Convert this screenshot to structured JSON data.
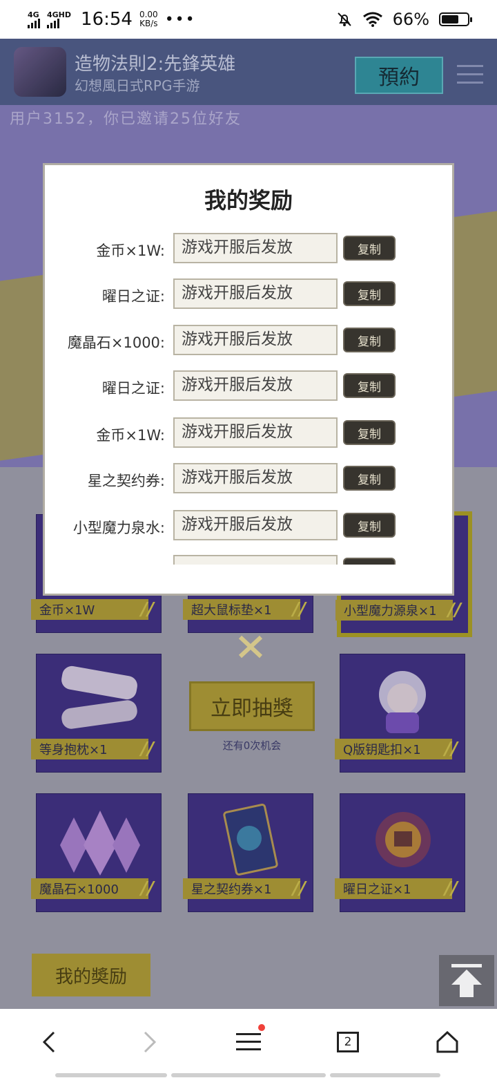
{
  "status_bar": {
    "signal1": "4G",
    "signal2": "4GHD",
    "time": "16:54",
    "speed_value": "0.00",
    "speed_unit": "KB/s",
    "more": "•••",
    "battery": "66%",
    "battery_level": 0.66
  },
  "header": {
    "title": "造物法則2:先鋒英雄",
    "subtitle": "幻想風日式RPG手游",
    "reserve_label": "預約"
  },
  "invite_text": "用户3152，你已邀请25位好友",
  "modal": {
    "title": "我的奖励",
    "rewards": [
      {
        "name": "金币×1W:",
        "value": "游戏开服后发放",
        "copy": "复制"
      },
      {
        "name": "曜日之证:",
        "value": "游戏开服后发放",
        "copy": "复制"
      },
      {
        "name": "魔晶石×1000:",
        "value": "游戏开服后发放",
        "copy": "复制"
      },
      {
        "name": "曜日之证:",
        "value": "游戏开服后发放",
        "copy": "复制"
      },
      {
        "name": "金币×1W:",
        "value": "游戏开服后发放",
        "copy": "复制"
      },
      {
        "name": "星之契约券:",
        "value": "游戏开服后发放",
        "copy": "复制"
      },
      {
        "name": "小型魔力泉水:",
        "value": "游戏开服后发放",
        "copy": "复制"
      },
      {
        "name": "",
        "value": "",
        "copy": ""
      }
    ]
  },
  "prizes": [
    {
      "label": "金币×1W"
    },
    {
      "label": "超大鼠标垫×1"
    },
    {
      "label": "小型魔力源泉×1"
    },
    {
      "label": "等身抱枕×1"
    },
    {
      "label": "Q版钥匙扣×1"
    },
    {
      "label": "魔晶石×1000"
    },
    {
      "label": "星之契约券×1"
    },
    {
      "label": "曜日之证×1"
    }
  ],
  "draw": {
    "button_label": "立即抽獎",
    "chances": "还有0次机会"
  },
  "my_reward_button": "我的奬励",
  "bottom_nav": {
    "tabs_count": "2"
  },
  "colors": {
    "modal_bg": "#ffffff",
    "copy_btn": "#37342e",
    "gold": "#a99634",
    "purple": "#3d2e7e"
  }
}
